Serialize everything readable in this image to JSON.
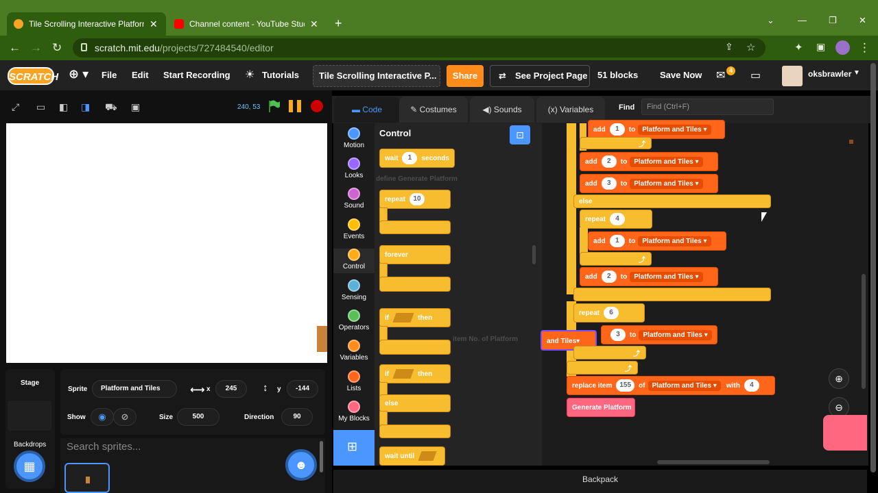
{
  "browser": {
    "tabs": [
      {
        "title": "Tile Scrolling Interactive Platform",
        "active": true
      },
      {
        "title": "Channel content - YouTube Studio",
        "active": false
      }
    ],
    "new_tab": "+",
    "url_domain": "scratch.mit.edu",
    "url_path": "/projects/727484540/editor"
  },
  "menubar": {
    "logo": "SCRATCH",
    "file": "File",
    "edit": "Edit",
    "start_recording": "Start Recording",
    "tutorials": "Tutorials",
    "project_title": "Tile Scrolling Interactive P...",
    "share": "Share",
    "see_project_page": "See Project Page",
    "blocks_count": "51 blocks",
    "save_now": "Save Now",
    "notification_count": "4",
    "username": "oksbrawler"
  },
  "stage": {
    "coords": "240, 53"
  },
  "sprite_info": {
    "sprite_label": "Sprite",
    "sprite_name": "Platform and Tiles",
    "x_label": "x",
    "x_value": "245",
    "y_label": "y",
    "y_value": "-144",
    "show_label": "Show",
    "size_label": "Size",
    "size_value": "500",
    "direction_label": "Direction",
    "direction_value": "90",
    "stage_label": "Stage",
    "backdrops_label": "Backdrops",
    "search_placeholder": "Search sprites..."
  },
  "editor_tabs": {
    "code": "Code",
    "costumes": "Costumes",
    "sounds": "Sounds",
    "variables": "Variables",
    "find_label": "Find",
    "find_placeholder": "Find (Ctrl+F)"
  },
  "categories": [
    {
      "name": "Motion",
      "color": "#4c97ff"
    },
    {
      "name": "Looks",
      "color": "#9966ff"
    },
    {
      "name": "Sound",
      "color": "#cf63cf"
    },
    {
      "name": "Events",
      "color": "#ffbf00"
    },
    {
      "name": "Control",
      "color": "#ffab19"
    },
    {
      "name": "Sensing",
      "color": "#5cb1d6"
    },
    {
      "name": "Operators",
      "color": "#59c059"
    },
    {
      "name": "Variables",
      "color": "#ff8c1a"
    },
    {
      "name": "Lists",
      "color": "#ff661a"
    },
    {
      "name": "My Blocks",
      "color": "#ff6680"
    }
  ],
  "palette": {
    "title": "Control",
    "wait": "wait",
    "wait_value": "1",
    "seconds": "seconds",
    "repeat": "repeat",
    "repeat_value": "10",
    "forever": "forever",
    "if": "if",
    "then": "then",
    "if2": "if",
    "then2": "then",
    "else": "else",
    "wait_until": "wait until"
  },
  "scripts": {
    "add": "add",
    "to": "to",
    "list": "Platform and Tiles",
    "v1": "1",
    "v2": "2",
    "v3": "3",
    "else": "else",
    "repeat": "repeat",
    "r4": "4",
    "r6": "6",
    "replace_item": "replace item",
    "replace_idx": "155",
    "of": "of",
    "with": "with",
    "with_val": "4",
    "drag_list": "and Tiles",
    "generate": "Generate Platform"
  },
  "backpack": "Backpack"
}
